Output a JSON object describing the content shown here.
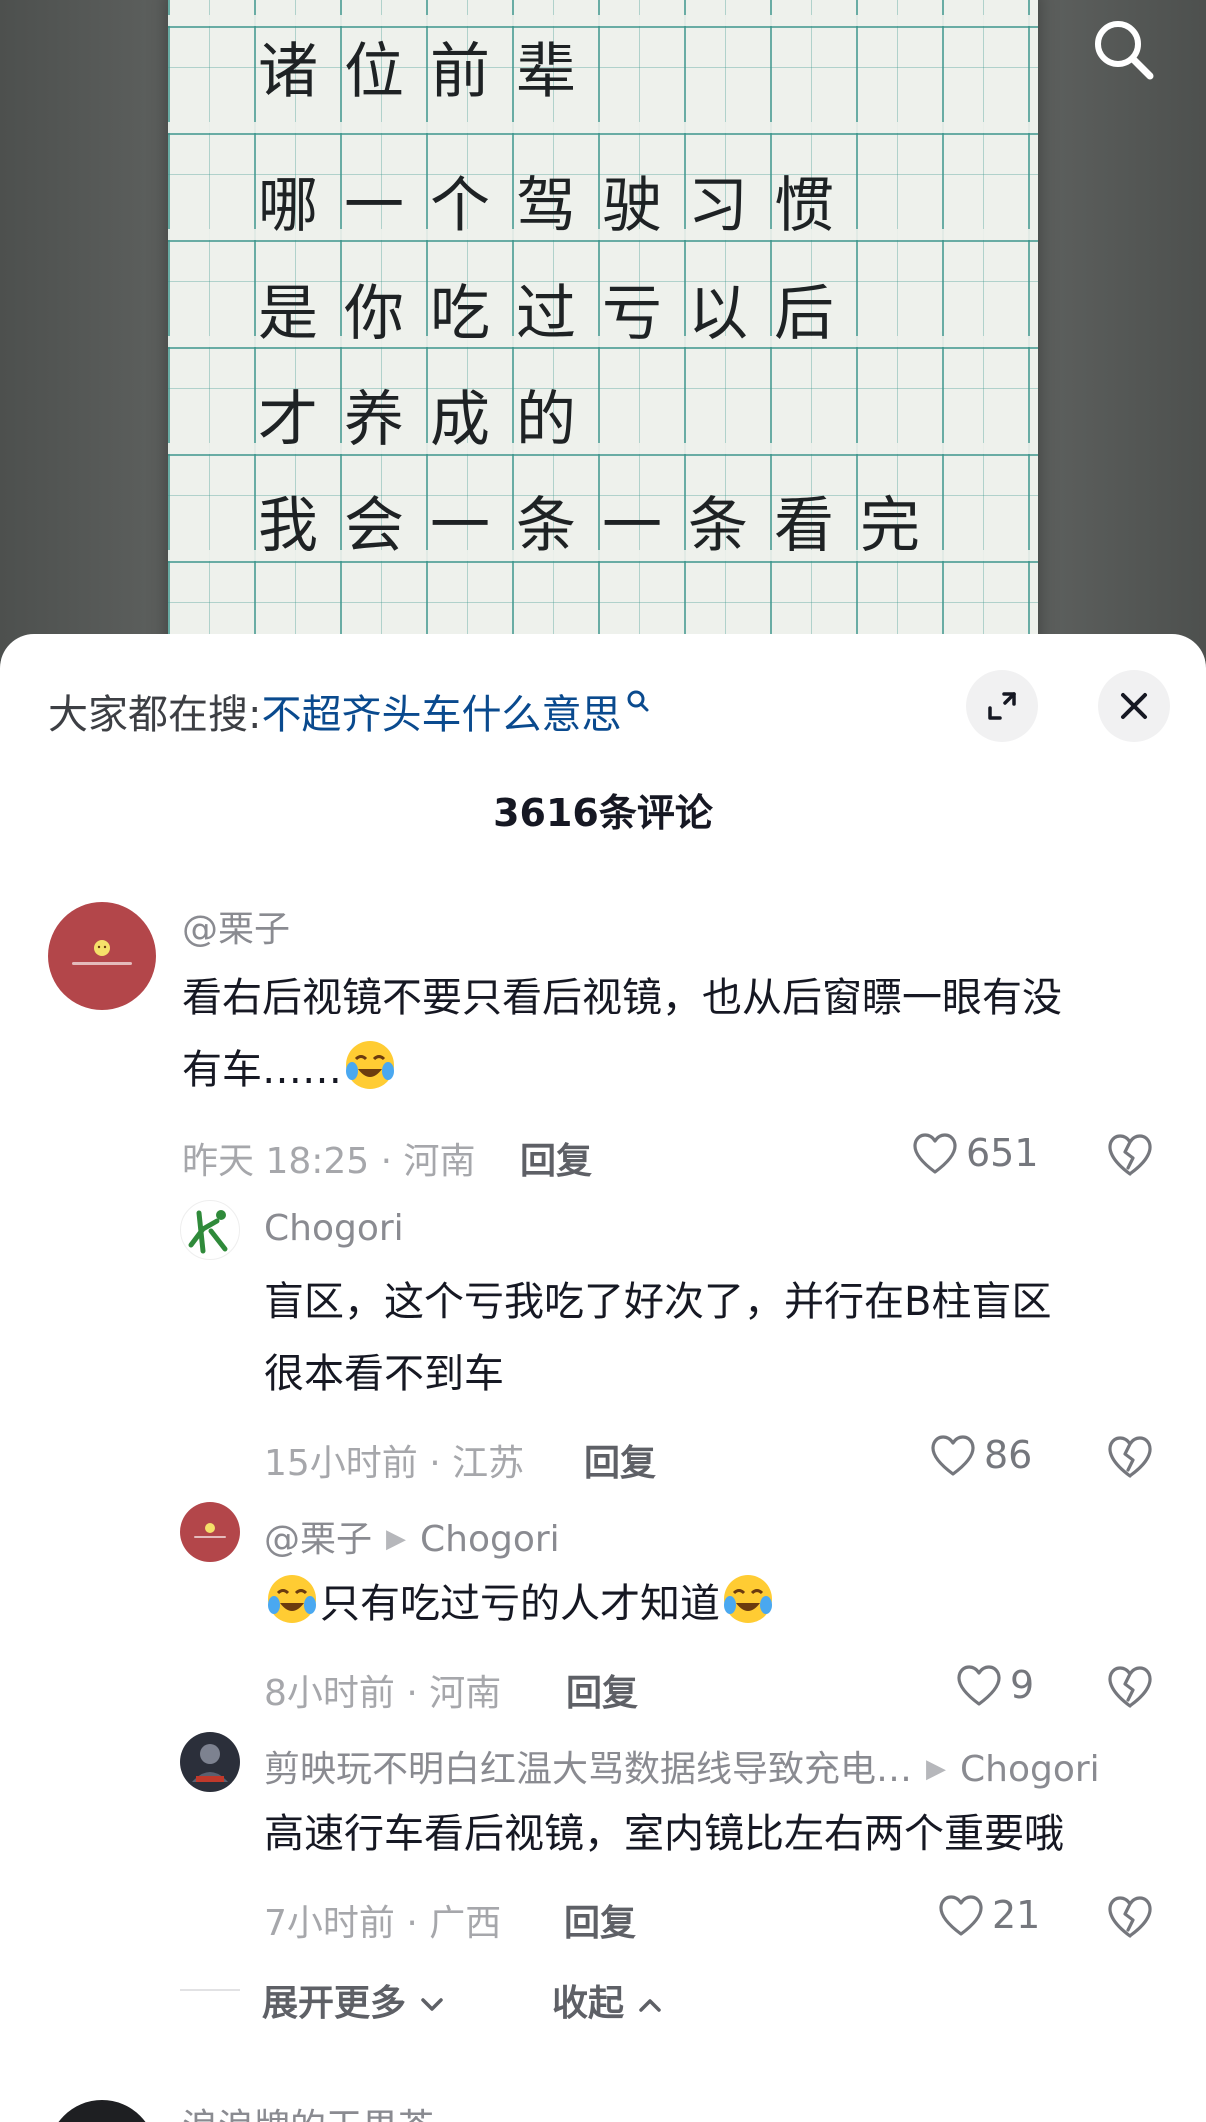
{
  "video": {
    "handwriting_lines": [
      "诸位前辈",
      "哪一个驾驶习惯",
      "是你吃过亏以后",
      "才养成的",
      "我会一条一条看完"
    ]
  },
  "hot_search": {
    "prefix": "大家都在搜:",
    "query": "不超齐头车什么意思"
  },
  "comment_count": "3616条评论",
  "comments": [
    {
      "username": "@栗子",
      "text_lines": [
        "看右后视镜不要只看后视镜，也从后窗瞟一眼有没",
        "有车……"
      ],
      "time_location": "昨天 18:25 · 河南",
      "reply_label": "回复",
      "likes": "651"
    },
    {
      "username": "Chogori",
      "text_lines": [
        "盲区，这个亏我吃了好次了，并行在B柱盲区",
        "很本看不到车"
      ],
      "time_location": "15小时前 · 江苏",
      "reply_label": "回复",
      "likes": "86"
    },
    {
      "username": "@栗子",
      "reply_to": "Chogori",
      "text": "只有吃过亏的人才知道",
      "time_location": "8小时前 · 河南",
      "reply_label": "回复",
      "likes": "9"
    },
    {
      "username": "剪映玩不明白红温大骂数据线导致充电…",
      "reply_to": "Chogori",
      "text": "高速行车看后视镜，室内镜比左右两个重要哦",
      "time_location": "7小时前 · 广西",
      "reply_label": "回复",
      "likes": "21"
    },
    {
      "username": "浪浪牌的干果茶"
    }
  ],
  "expand_more": "展开更多",
  "collapse": "收起",
  "colors": {
    "link_blue": "#0a4a8e",
    "avatar_red": "#b3464a",
    "meta_gray": "#a6a7ab"
  },
  "icons": [
    "search-icon",
    "expand-icon",
    "close-icon",
    "heart-icon",
    "broken-heart-icon",
    "laugh-cry-emoji",
    "chevron-down-icon",
    "chevron-up-icon",
    "search-small-icon"
  ]
}
